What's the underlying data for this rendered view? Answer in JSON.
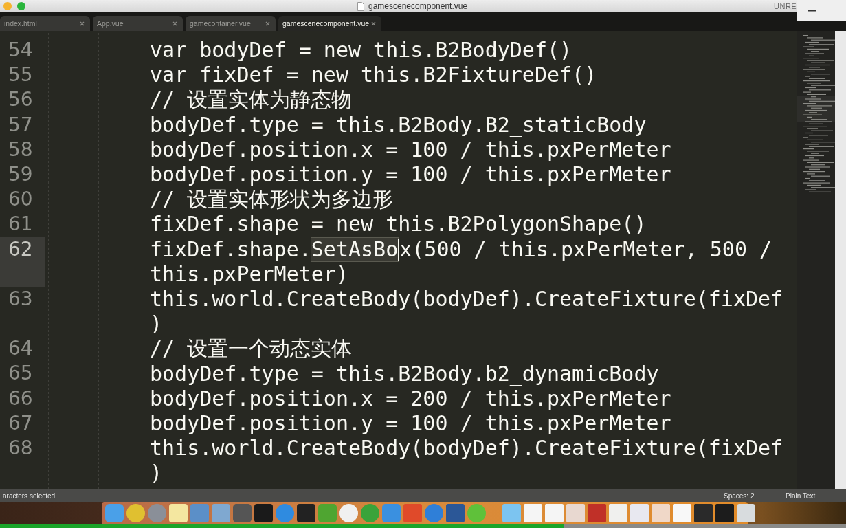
{
  "window": {
    "title": "gamescenecomponent.vue",
    "license": "UNRE"
  },
  "tabs": [
    {
      "label": "index.html",
      "selected": false
    },
    {
      "label": "App.vue",
      "selected": false
    },
    {
      "label": "gamecontainer.vue",
      "selected": false
    },
    {
      "label": "gamescenecomponent.vue",
      "selected": true
    }
  ],
  "editor": {
    "lines": [
      {
        "number": "54",
        "current": false,
        "rows": [
          {
            "text": "var bodyDef = new this.B2BodyDef()"
          }
        ]
      },
      {
        "number": "55",
        "current": false,
        "rows": [
          {
            "text": "var fixDef = new this.B2FixtureDef()"
          }
        ]
      },
      {
        "number": "56",
        "current": false,
        "rows": [
          {
            "text": "// 设置实体为静态物"
          }
        ]
      },
      {
        "number": "57",
        "current": false,
        "rows": [
          {
            "text": "bodyDef.type = this.B2Body.B2_staticBody"
          }
        ]
      },
      {
        "number": "58",
        "current": false,
        "rows": [
          {
            "text": "bodyDef.position.x = 100 / this.pxPerMeter"
          }
        ]
      },
      {
        "number": "59",
        "current": false,
        "rows": [
          {
            "text": "bodyDef.position.y = 100 / this.pxPerMeter"
          }
        ]
      },
      {
        "number": "60",
        "current": false,
        "rows": [
          {
            "text": "// 设置实体形状为多边形"
          }
        ]
      },
      {
        "number": "61",
        "current": false,
        "rows": [
          {
            "text": "fixDef.shape = new this.B2PolygonShape()"
          }
        ]
      },
      {
        "number": "62",
        "current": true,
        "rows": [
          {
            "before": "fixDef.shape.",
            "match": "SetAsBo",
            "after": "x(500 / this.pxPerMeter, 500 /"
          },
          {
            "text": "this.pxPerMeter)"
          }
        ]
      },
      {
        "number": "63",
        "current": false,
        "rows": [
          {
            "text": "this.world.CreateBody(bodyDef).CreateFixture(fixDef"
          },
          {
            "text": ")"
          }
        ]
      },
      {
        "number": "64",
        "current": false,
        "rows": [
          {
            "text": "// 设置一个动态实体"
          }
        ]
      },
      {
        "number": "65",
        "current": false,
        "rows": [
          {
            "text": "bodyDef.type = this.B2Body.b2_dynamicBody"
          }
        ]
      },
      {
        "number": "66",
        "current": false,
        "rows": [
          {
            "text": "bodyDef.position.x = 200 / this.pxPerMeter"
          }
        ]
      },
      {
        "number": "67",
        "current": false,
        "rows": [
          {
            "text": "bodyDef.position.y = 100 / this.pxPerMeter"
          }
        ]
      },
      {
        "number": "68",
        "current": false,
        "rows": [
          {
            "text": "this.world.CreateBody(bodyDef).CreateFixture(fixDef"
          },
          {
            "text": ")"
          }
        ]
      }
    ]
  },
  "playback": {
    "level": 0.667
  },
  "status_bar": {
    "selection": "aracters selected",
    "indentation": "Spaces: 2",
    "syntax": "Plain Text"
  }
}
